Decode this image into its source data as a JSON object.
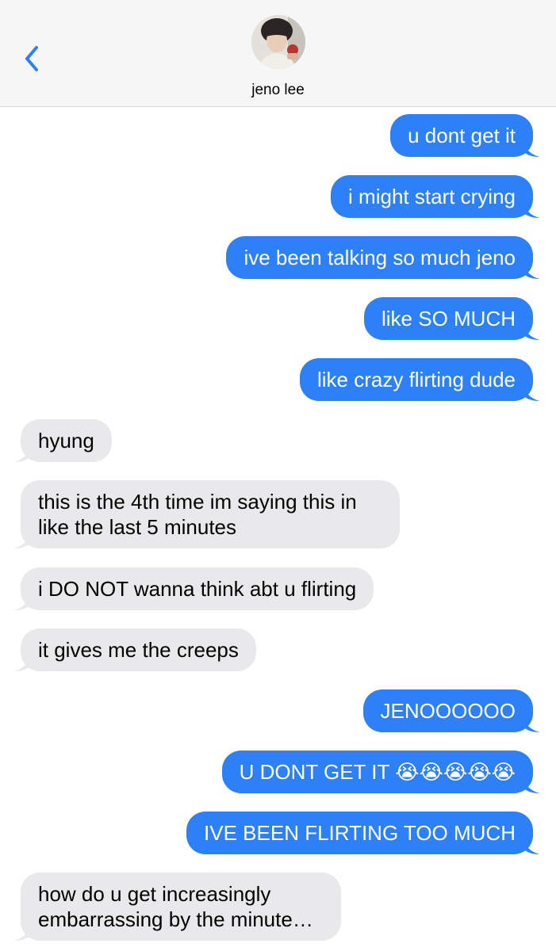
{
  "header": {
    "contact_name": "jeno lee",
    "back_icon": "chevron-left-icon",
    "accent_color": "#2e80f6"
  },
  "messages": [
    {
      "side": "sent",
      "text": "u dont get it"
    },
    {
      "side": "sent",
      "text": "i might start crying"
    },
    {
      "side": "sent",
      "text": "ive been talking so much jeno"
    },
    {
      "side": "sent",
      "text": "like SO MUCH"
    },
    {
      "side": "sent",
      "text": "like crazy flirting dude"
    },
    {
      "side": "recv",
      "text": "hyung"
    },
    {
      "side": "recv",
      "text": "this is the 4th time im saying this in like the last 5 minutes"
    },
    {
      "side": "recv",
      "text": "i DO NOT wanna think abt u flirting"
    },
    {
      "side": "recv",
      "text": "it gives me the creeps"
    },
    {
      "side": "sent",
      "text": "JENOOOOOO"
    },
    {
      "side": "sent",
      "text": "U DONT GET IT 😭😭😭😭😭"
    },
    {
      "side": "sent",
      "text": "IVE BEEN FLIRTING TOO MUCH"
    },
    {
      "side": "recv",
      "text": "how do u get increasingly embarrassing by the minute…"
    }
  ],
  "colors": {
    "sent_bubble": "#2e80f6",
    "received_bubble": "#e9e9eb",
    "header_bg": "#f6f6f7"
  }
}
